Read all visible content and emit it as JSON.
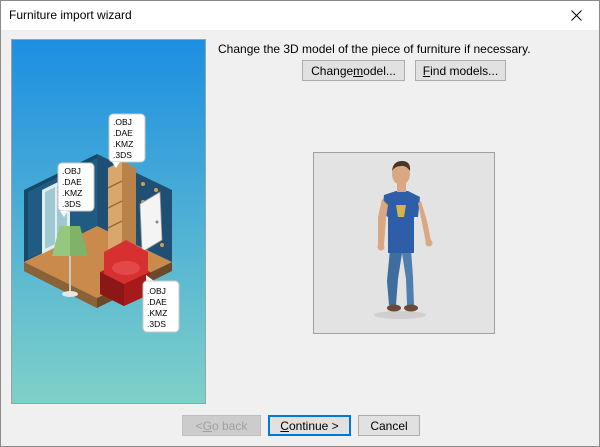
{
  "window": {
    "title": "Furniture import wizard"
  },
  "instruction": "Change the 3D model of the piece of furniture if necessary.",
  "buttons": {
    "change_model": {
      "pre": "Change ",
      "u": "m",
      "post": "odel..."
    },
    "find_models": {
      "pre": "",
      "u": "F",
      "post": "ind models..."
    },
    "go_back": {
      "pre": "< ",
      "u": "G",
      "post": "o back"
    },
    "continue": {
      "pre": "",
      "u": "C",
      "post": "ontinue >"
    },
    "cancel": "Cancel"
  },
  "format_labels": {
    "top": [
      ".OBJ",
      ".DAE",
      ".KMZ",
      ".3DS"
    ],
    "left": [
      ".OBJ",
      ".DAE",
      ".KMZ",
      ".3DS"
    ],
    "bottom": [
      ".OBJ",
      ".DAE",
      ".KMZ",
      ".3DS"
    ]
  },
  "colors": {
    "accent": "#0078d7",
    "panel_top": "#1d8fe2",
    "panel_bottom": "#7fd1c7"
  }
}
